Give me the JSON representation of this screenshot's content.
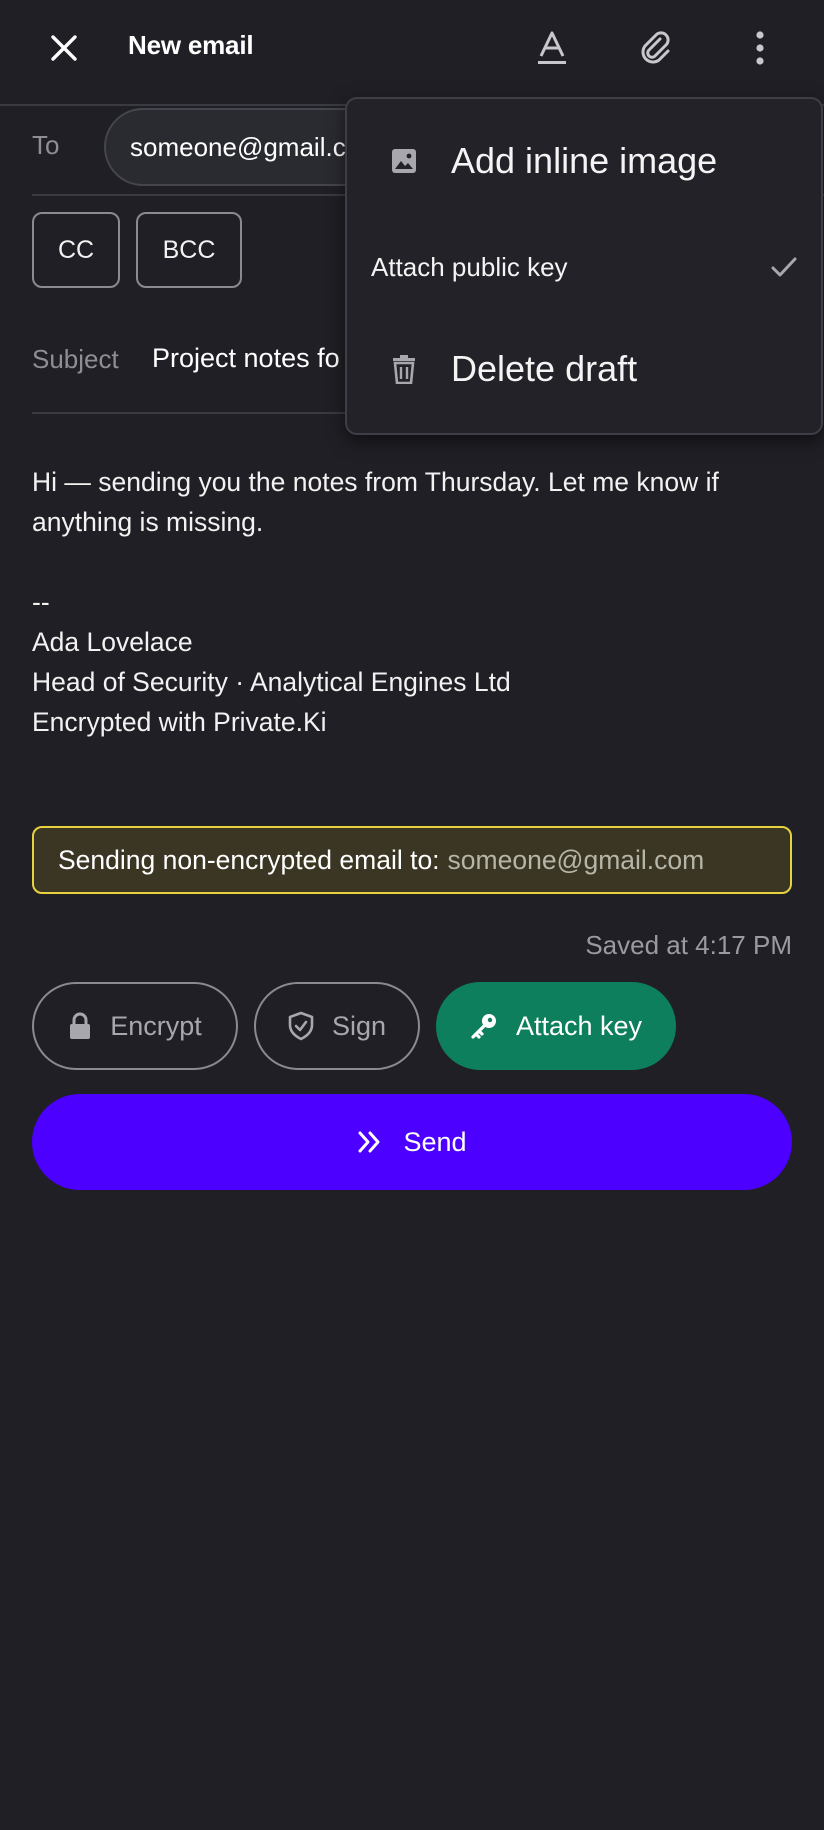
{
  "header": {
    "title": "New email",
    "close_icon": "close-icon",
    "format_icon": "text-format-icon",
    "attach_icon": "paperclip-icon",
    "more_icon": "more-vert-icon"
  },
  "recipients": {
    "to_label": "To",
    "to_value": "someone@gmail.com",
    "cc_label": "CC",
    "bcc_label": "BCC"
  },
  "subject": {
    "label": "Subject",
    "value": "Project notes fo"
  },
  "body": {
    "text": "Hi — sending you the notes from Thursday. Let me know if anything is missing.\n\n--\nAda Lovelace\nHead of Security · Analytical Engines Ltd\nEncrypted with Private.Ki"
  },
  "warning": {
    "label": "Sending non-encrypted email to:",
    "address": "someone@gmail.com",
    "border_color": "#e6d23f"
  },
  "status": {
    "saved": "Saved at 4:17 PM"
  },
  "actions": {
    "encrypt": "Encrypt",
    "sign": "Sign",
    "attach_key": "Attach key",
    "attach_key_color": "#0e7f5c",
    "send": "Send",
    "send_color": "#4c00ff"
  },
  "menu": {
    "items": [
      {
        "label": "Add inline image",
        "icon": "image-icon"
      },
      {
        "label": "Attach public key",
        "checked": true,
        "icon": "check-icon"
      },
      {
        "label": "Delete draft",
        "icon": "trash-icon"
      }
    ]
  }
}
